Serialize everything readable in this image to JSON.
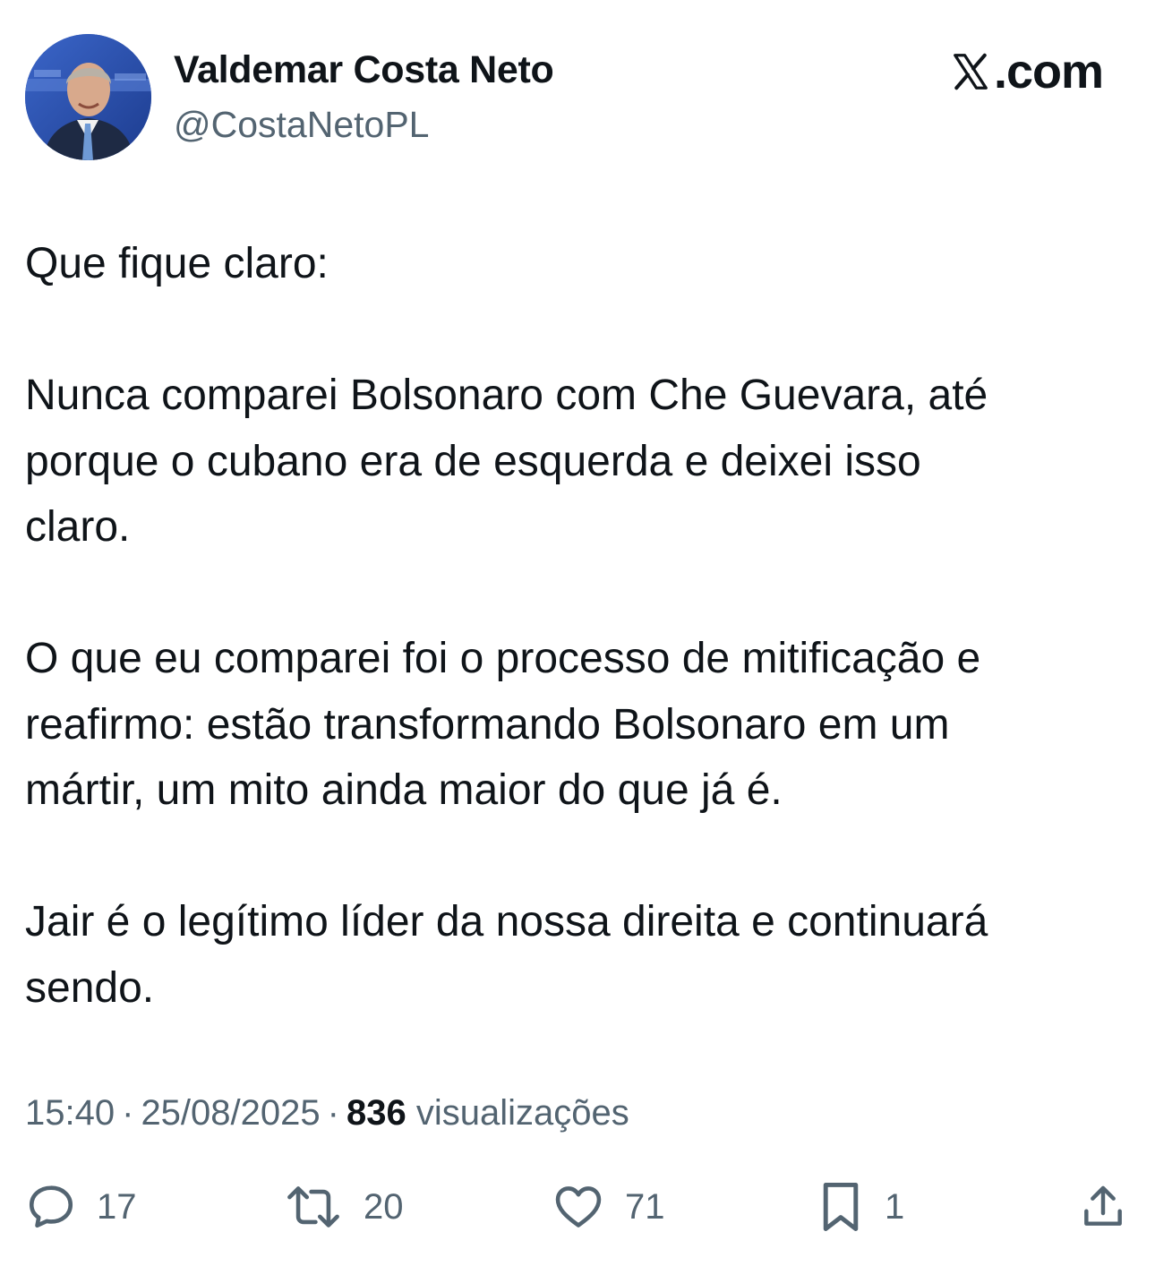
{
  "author": {
    "display_name": "Valdemar Costa Neto",
    "handle": "@CostaNetoPL"
  },
  "brand": {
    "text": ".com"
  },
  "tweet": {
    "paragraphs": [
      "Que fique claro:",
      "Nunca comparei Bolsonaro com Che Guevara, até\nporque o cubano era de esquerda e deixei isso\nclaro.",
      "O que eu comparei foi o processo de mitificação e\nreafirmo: estão transformando Bolsonaro em um\nmártir, um mito ainda maior do que já é.",
      "Jair é o legítimo líder da nossa direita e continuará\nsendo."
    ]
  },
  "meta": {
    "time": "15:40",
    "separator": "·",
    "date": "25/08/2025",
    "views_count": "836",
    "views_label": "visualizações"
  },
  "actions": {
    "replies": "17",
    "retweets": "20",
    "likes": "71",
    "bookmarks": "1"
  },
  "icons": {
    "reply": "speech-bubble-icon",
    "retweet": "retweet-arrows-icon",
    "like": "heart-icon",
    "bookmark": "bookmark-icon",
    "share": "share-upload-icon"
  },
  "colors": {
    "text_primary": "#0f1419",
    "text_secondary": "#536471",
    "avatar_background": "#2a4fae"
  }
}
